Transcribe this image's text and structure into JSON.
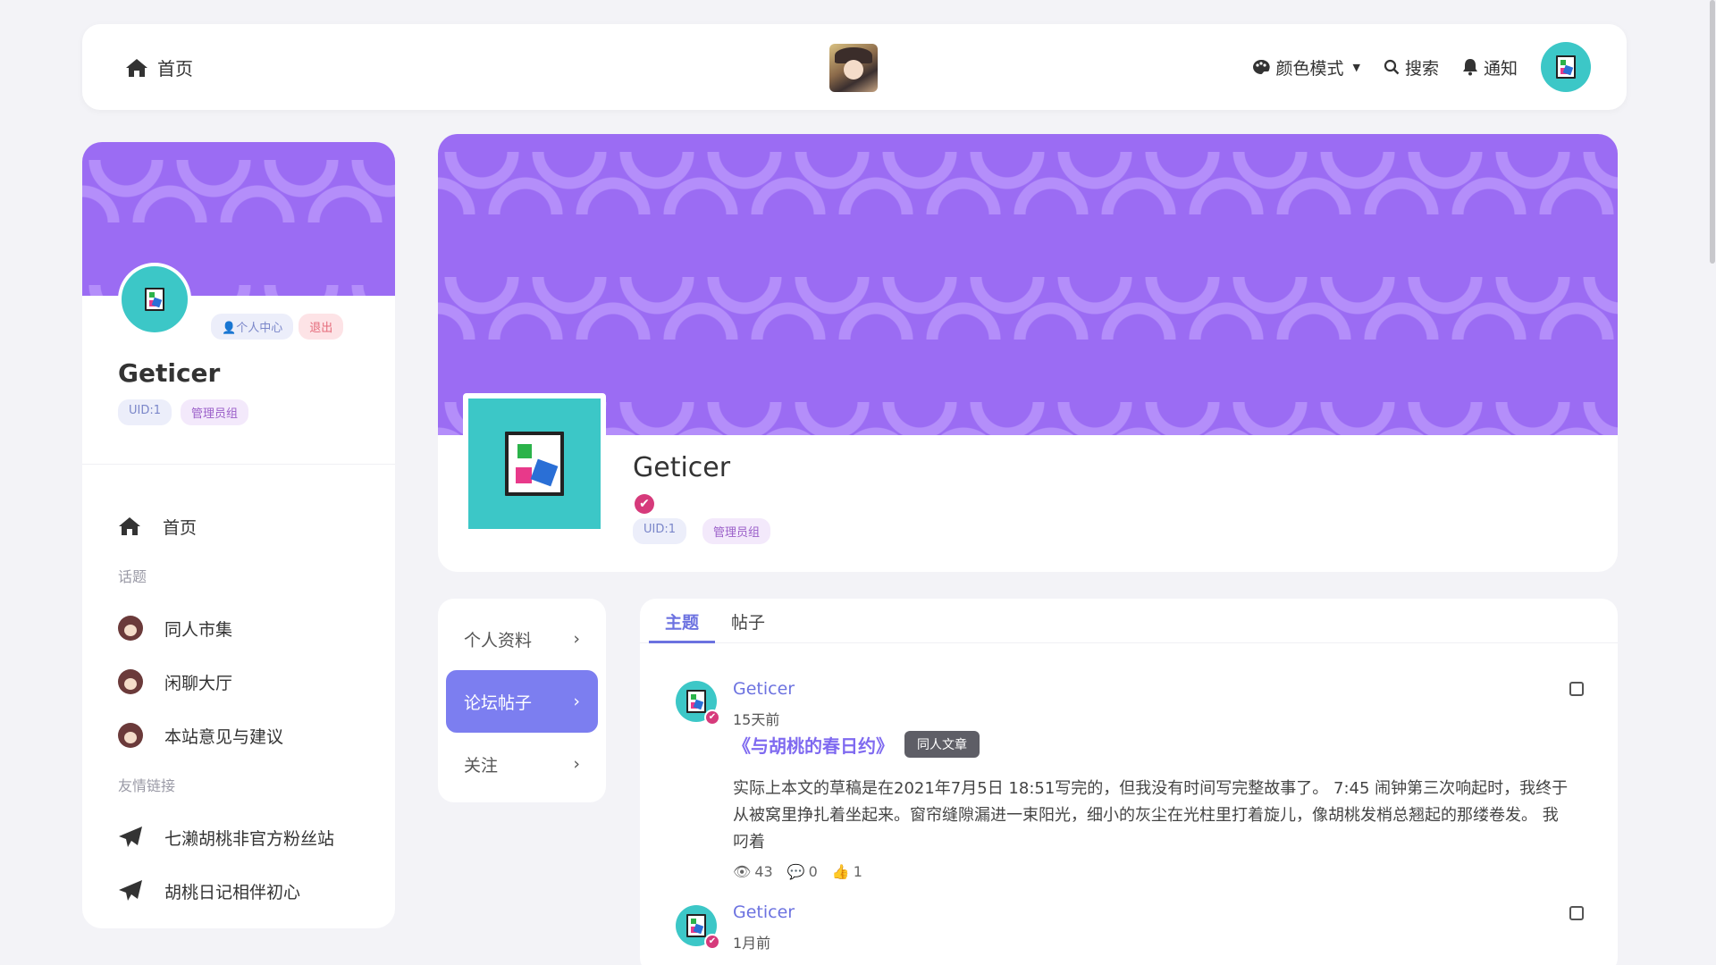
{
  "nav": {
    "home": "首页",
    "color_mode": "颜色模式",
    "search": "搜索",
    "notify": "通知"
  },
  "sidebar": {
    "btn_center": "个人中心",
    "btn_logout": "退出",
    "name": "Geticer",
    "uid": "UID:1",
    "group": "管理员组",
    "home": "首页",
    "section_topics": "话题",
    "topics": [
      "同人市集",
      "闲聊大厅",
      "本站意见与建议"
    ],
    "section_links": "友情链接",
    "links": [
      "七濑胡桃非官方粉丝站",
      "胡桃日记相伴初心"
    ]
  },
  "profile": {
    "name": "Geticer",
    "uid": "UID:1",
    "group": "管理员组"
  },
  "menu": {
    "items": [
      "个人资料",
      "论坛帖子",
      "关注"
    ]
  },
  "tabs": [
    "主题",
    "帖子"
  ],
  "posts": [
    {
      "author": "Geticer",
      "time": "15天前",
      "title": "《与胡桃的春日约》",
      "tag": "同人文章",
      "body": "实际上本文的草稿是在2021年7月5日 18:51写完的，但我没有时间写完整故事了。 7:45 闹钟第三次响起时，我终于从被窝里挣扎着坐起来。窗帘缝隙漏进一束阳光，细小的灰尘在光柱里打着旋儿，像胡桃发梢总翘起的那缕卷发。 我叼着",
      "views": "43",
      "comments": "0",
      "likes": "1"
    },
    {
      "author": "Geticer",
      "time": "1月前"
    }
  ]
}
